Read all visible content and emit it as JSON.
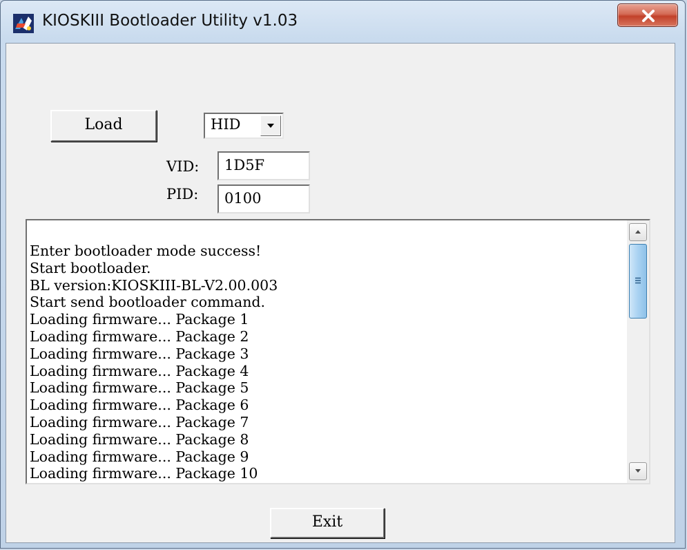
{
  "window": {
    "title": "KIOSKIII Bootloader Utility v1.03",
    "icon": "kiosk-app-icon",
    "close_icon": "close-icon",
    "close_color": "#c2412a"
  },
  "controls": {
    "load_label": "Load",
    "interface_select": {
      "selected": "HID"
    },
    "vid_label": "VID:",
    "vid_value": "1D5F",
    "pid_label": "PID:",
    "pid_value": "0100",
    "exit_label": "Exit"
  },
  "log": {
    "lines": [
      "Enter bootloader mode success!",
      "Start bootloader.",
      "BL version:KIOSKIII-BL-V2.00.003",
      "Start send bootloader command.",
      "Loading firmware... Package 1",
      "Loading firmware... Package 2",
      "Loading firmware... Package 3",
      "Loading firmware... Package 4",
      "Loading firmware... Package 5",
      "Loading firmware... Package 6",
      "Loading firmware... Package 7",
      "Loading firmware... Package 8",
      "Loading firmware... Package 9",
      "Loading firmware... Package 10"
    ],
    "scrollbar": {
      "up_icon": "scroll-up-arrow-icon",
      "down_icon": "scroll-down-arrow-icon",
      "thumb_icon": "scroll-grip-icon"
    }
  }
}
